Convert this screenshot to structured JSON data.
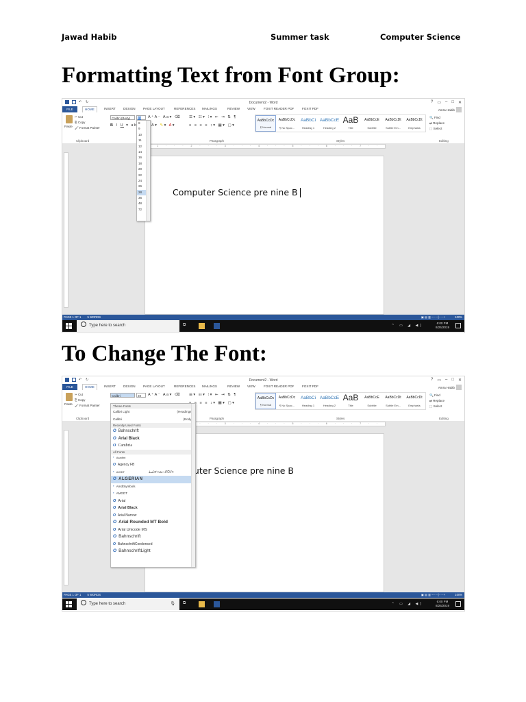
{
  "header": {
    "author": "Jawad Habib",
    "task": "Summer task",
    "subject": "Computer Science"
  },
  "headings": {
    "first": "Formatting Text from Font Group:",
    "second": "To Change The Font:"
  },
  "word": {
    "doc_title": "Document2 - Word",
    "window_controls": [
      "?",
      "▭",
      "–",
      "□",
      "✕"
    ],
    "tabs": [
      "FILE",
      "HOME",
      "INSERT",
      "DESIGN",
      "PAGE LAYOUT",
      "REFERENCES",
      "MAILINGS",
      "REVIEW",
      "VIEW",
      "FOXIT READER PDF",
      "FOXIT PDF"
    ],
    "user": "Amra Habib",
    "clipboard": {
      "paste": "Paste",
      "cut": "Cut",
      "copy": "Copy",
      "format_painter": "Format Painter",
      "label": "Clipboard"
    },
    "font_group": {
      "font_1": "Calibri (Body)",
      "size_1": "28",
      "font_2": "Calibri",
      "size_2": "28",
      "label": "Paragraph"
    },
    "styles": [
      {
        "preview": "AaBbCcDc",
        "name": "¶ Normal"
      },
      {
        "preview": "AaBbCcDc",
        "name": "¶ No Spac..."
      },
      {
        "preview": "AaBbCi",
        "name": "Heading 1"
      },
      {
        "preview": "AaBbCcE",
        "name": "Heading 2"
      },
      {
        "preview": "AaB",
        "name": "Title"
      },
      {
        "preview": "AaBbCcE",
        "name": "Subtitle"
      },
      {
        "preview": "AaBbCcDt",
        "name": "Subtle Em..."
      },
      {
        "preview": "AaBbCcDt",
        "name": "Emphasis"
      }
    ],
    "styles_label": "Styles",
    "editing": {
      "find": "Find",
      "replace": "Replace",
      "select": "Select",
      "label": "Editing"
    },
    "ruler_text": "· 1 · · · 2 · · · 3 · · · 4 · · · 5 · · · 6 · · · 7 · · ·",
    "document_text_1": "Computer Science pre nine B",
    "document_text_2": "puter Science pre nine B",
    "status_page": "PAGE 1 OF 1",
    "status_words": "5 WORDS",
    "zoom": "100%",
    "font_sizes": [
      "8",
      "9",
      "10",
      "11",
      "12",
      "14",
      "16",
      "18",
      "20",
      "22",
      "24",
      "26",
      "28",
      "36",
      "48",
      "72"
    ],
    "font_list": {
      "theme_header": "Theme Fonts",
      "theme_fonts": [
        {
          "name": "Calibri Light",
          "role": "(Headings)"
        },
        {
          "name": "Calibri",
          "role": "(Body)"
        }
      ],
      "recent_header": "Recently Used Fonts",
      "recent_fonts": [
        "Bahnschrift",
        "Arial Black",
        "Cambria"
      ],
      "all_header": "All Fonts",
      "all_fonts": [
        "Acadfnt",
        "Agency FB",
        "AIGDT",
        "ALGERIAN",
        "AmdtSymbols",
        "AMGDT",
        "Arial",
        "Arial Black",
        "Arial Narrow",
        "Arial Rounded MT Bold",
        "Arial Unicode MS",
        "Bahnschrift",
        "BahnschriftCondensed",
        "BahnschriftLight"
      ],
      "aigdt_sample": "⟂∠⌭○⌓⌒//⊙⫽⌖"
    }
  },
  "taskbar": {
    "search_placeholder": "Type here to search",
    "time": "6:00 PM",
    "date": "8/25/2019"
  }
}
